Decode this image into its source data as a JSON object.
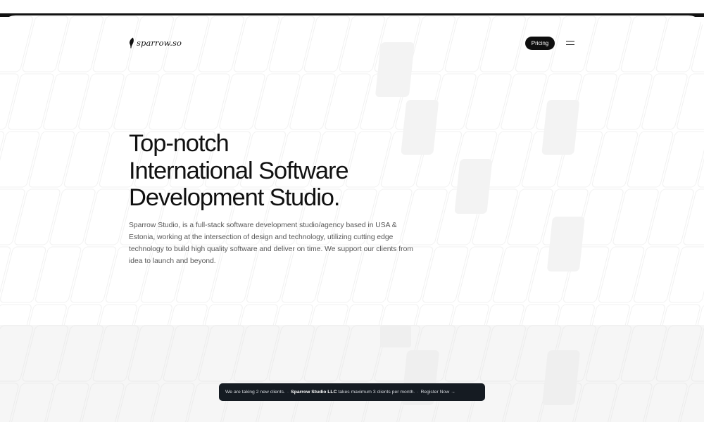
{
  "brand": {
    "logo_text": "sparrow.so",
    "logo_icon": "quill-icon"
  },
  "nav": {
    "pricing_label": "Pricing",
    "menu_icon": "menu-icon"
  },
  "hero": {
    "title_lines": [
      "Top-notch",
      "International Software",
      "Development Studio."
    ],
    "description": "Sparrow Studio, is a full-stack software development studio/agency based in USA & Estonia, working at the intersection of design and technology, utilizing cutting edge technology to build high quality software and deliver on time. We support our clients from idea to launch and beyond."
  },
  "notice": {
    "lead": "We are taking 2 new clients.",
    "company": "Sparrow Studio LLC",
    "detail": "takes maximum 3 clients per month.",
    "cta": "Register Now →"
  },
  "colors": {
    "text_primary": "#111111",
    "text_secondary": "#555555",
    "button_dark": "#0e0e0e",
    "notice_bg": "#151b22"
  }
}
